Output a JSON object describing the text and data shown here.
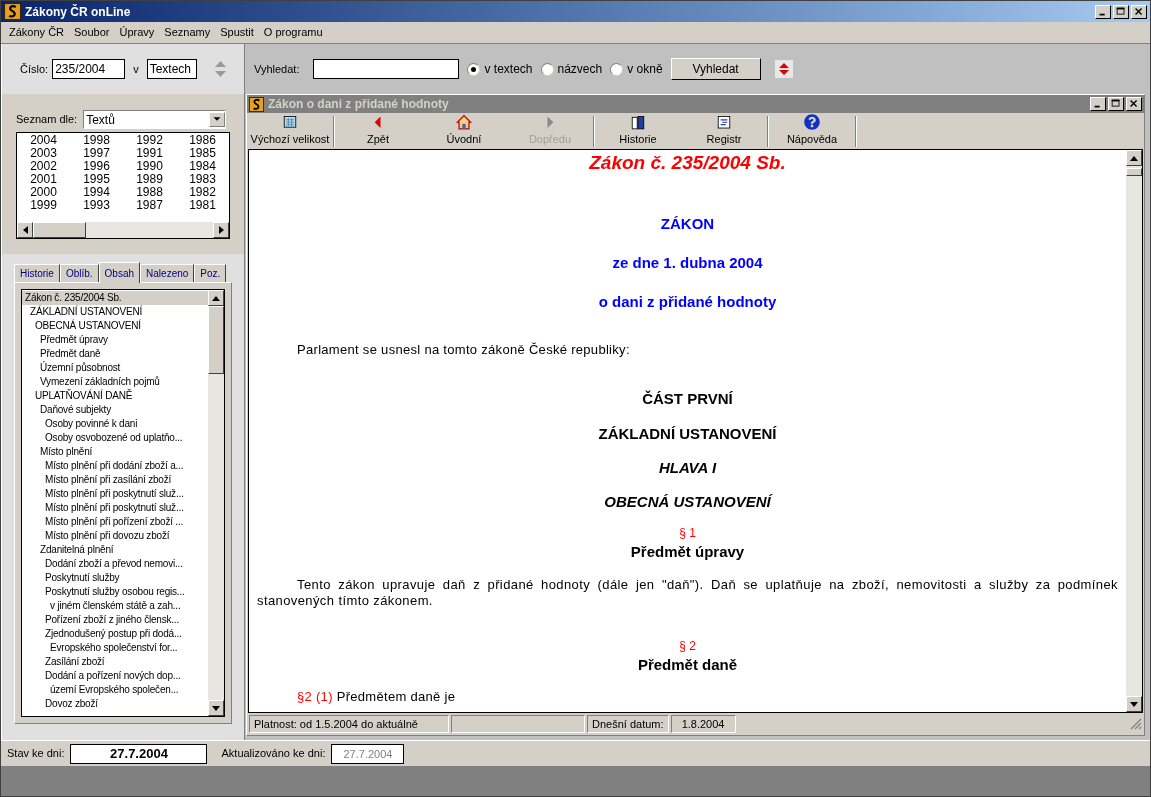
{
  "window": {
    "title": "Zákony ČR onLine"
  },
  "menu": [
    "Zákony ČR",
    "Soubor",
    "Úpravy",
    "Seznamy",
    "Spustit",
    "O programu"
  ],
  "number_search": {
    "label": "Číslo:",
    "value": "235/2004",
    "in_label": "v",
    "scope": "Textech"
  },
  "search": {
    "label": "Vyhledat:",
    "options": [
      {
        "label": "v textech",
        "selected": true
      },
      {
        "label": "názvech",
        "selected": false
      },
      {
        "label": "v okně",
        "selected": false
      }
    ],
    "button": "Vyhledat"
  },
  "list_by": {
    "label": "Seznam dle:",
    "value": "Textů"
  },
  "years": [
    "2004",
    "2003",
    "2002",
    "2001",
    "2000",
    "1999",
    "1998",
    "1997",
    "1996",
    "1995",
    "1994",
    "1993",
    "1992",
    "1991",
    "1990",
    "1989",
    "1988",
    "1987",
    "1986",
    "1985",
    "1984",
    "1983",
    "1982",
    "1981"
  ],
  "tabs": [
    {
      "label": "Historie",
      "selected": false
    },
    {
      "label": "Oblíb.",
      "selected": false
    },
    {
      "label": "Obsah",
      "selected": true
    },
    {
      "label": "Nalezeno",
      "selected": false
    },
    {
      "label": "Poz.",
      "selected": false
    }
  ],
  "contents_tree": [
    {
      "label": "Zákon č. 235/2004 Sb.",
      "selected": true,
      "children": [
        {
          "label": "ZÁKLADNÍ USTANOVENÍ",
          "selected": false,
          "children": [
            {
              "label": "OBECNÁ USTANOVENÍ",
              "selected": false,
              "children": [
                {
                  "label": "Předmět úpravy",
                  "selected": false
                },
                {
                  "label": "Předmět daně",
                  "selected": false
                },
                {
                  "label": "Územní působnost",
                  "selected": false
                },
                {
                  "label": "Vymezení základních pojmů",
                  "selected": false
                }
              ]
            },
            {
              "label": "UPLATŇOVÁNÍ DANĚ",
              "selected": false,
              "children": [
                {
                  "label": "Daňové subjekty",
                  "selected": false,
                  "children": [
                    {
                      "label": "Osoby povinné k dani",
                      "selected": false
                    },
                    {
                      "label": "Osoby osvobozené od uplatňo...",
                      "selected": false
                    }
                  ]
                },
                {
                  "label": "Místo plnění",
                  "selected": false,
                  "children": [
                    {
                      "label": "Místo plnění při dodání zboží a...",
                      "selected": false
                    },
                    {
                      "label": "Místo plnění při zasílání zboží",
                      "selected": false
                    },
                    {
                      "label": "Místo plnění při poskytnutí služ...",
                      "selected": false
                    },
                    {
                      "label": "Místo plnění při poskytnutí služ...",
                      "selected": false
                    },
                    {
                      "label": "Místo plnění při pořízení zboží ...",
                      "selected": false
                    },
                    {
                      "label": "Místo plnění při dovozu zboží",
                      "selected": false
                    }
                  ]
                },
                {
                  "label": "Zdanitelná plnění",
                  "selected": false,
                  "children": [
                    {
                      "label": "Dodání zboží a převod nemovi...",
                      "selected": false
                    },
                    {
                      "label": "Poskytnutí služby",
                      "selected": false
                    },
                    {
                      "label": "Poskytnutí služby osobou regis...",
                      "selected": false,
                      "children": [
                        {
                          "label": "v jiném členském státě a zah...",
                          "selected": false
                        }
                      ]
                    },
                    {
                      "label": "Pořízení zboží z jiného člensk...",
                      "selected": false
                    },
                    {
                      "label": "Zjednodušený postup při dodá...",
                      "selected": false,
                      "children": [
                        {
                          "label": "Evropského společenství for...",
                          "selected": false
                        }
                      ]
                    },
                    {
                      "label": "Zasílání zboží",
                      "selected": false
                    },
                    {
                      "label": "Dodání a pořízení nových dop...",
                      "selected": false,
                      "children": [
                        {
                          "label": "území Evropského společen...",
                          "selected": false
                        }
                      ]
                    },
                    {
                      "label": "Dovoz zboží",
                      "selected": false
                    }
                  ]
                }
              ]
            }
          ]
        }
      ]
    }
  ],
  "state_date": {
    "label": "Stav ke dni:",
    "value": "27.7.2004"
  },
  "updated_date": {
    "label": "Aktualizováno ke dni:",
    "value": "27.7.2004",
    "disabled": true
  },
  "document_window": {
    "title": "Zákon o dani z přidané hodnoty",
    "toolbar": [
      {
        "label": "Výchozí velikost",
        "kind": "size",
        "disabled": false
      },
      {
        "label": "Zpět",
        "kind": "back",
        "disabled": false
      },
      {
        "label": "Úvodní",
        "kind": "home",
        "disabled": false
      },
      {
        "label": "Dopředu",
        "kind": "forward",
        "disabled": true
      },
      {
        "label": "Historie",
        "kind": "history",
        "disabled": false
      },
      {
        "label": "Registr",
        "kind": "register",
        "disabled": false
      },
      {
        "label": "Nápověda",
        "kind": "help",
        "disabled": false
      }
    ],
    "content": [
      {
        "kind": "law_title",
        "text": "Zákon č. 235/2004 Sb."
      },
      {
        "kind": "blue_heading",
        "text": "ZÁKON"
      },
      {
        "kind": "blue_heading",
        "text": "ze dne 1. dubna 2004"
      },
      {
        "kind": "blue_heading",
        "text": "o dani z přidané hodnoty"
      },
      {
        "kind": "intro",
        "text": "Parlament se usnesl na tomto zákoně České republiky:"
      },
      {
        "kind": "part_heading",
        "text": "ČÁST PRVNÍ"
      },
      {
        "kind": "part_heading",
        "text": "ZÁKLADNÍ USTANOVENÍ"
      },
      {
        "kind": "italic_heading",
        "text": "HLAVA I"
      },
      {
        "kind": "italic_heading",
        "text": "OBECNÁ USTANOVENÍ"
      },
      {
        "kind": "section_mark",
        "text": "§ 1"
      },
      {
        "kind": "section_title",
        "text": "Předmět úpravy"
      },
      {
        "kind": "paragraph",
        "text": "Tento zákon upravuje daň z přidané hodnoty (dále jen \"daň\"). Daň se uplatňuje na zboží, nemovitosti a služby za podmínek stanovených tímto zákonem."
      },
      {
        "kind": "section_mark",
        "text": "§ 2"
      },
      {
        "kind": "section_title",
        "text": "Předmět daně"
      },
      {
        "kind": "clause",
        "mark": "§2 (1)",
        "text": "Předmětem daně je"
      }
    ],
    "status": {
      "validity": "Platnost: od 1.5.2004 do aktuálně",
      "today_label": "Dnešní datum:",
      "today_value": "1.8.2004"
    }
  }
}
